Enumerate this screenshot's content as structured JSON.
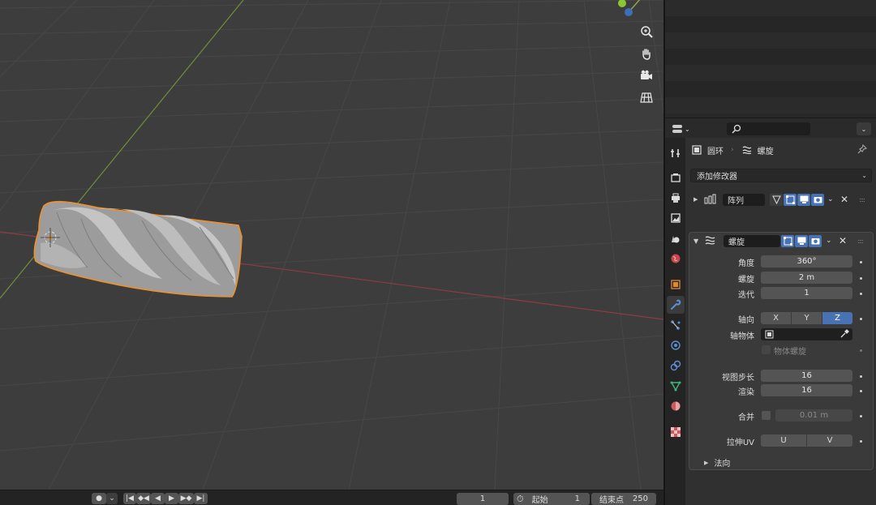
{
  "viewport": {
    "nav_icons": [
      "zoom-icon",
      "hand-pan-icon",
      "camera-icon",
      "grid-view-icon"
    ]
  },
  "timeline": {
    "current_frame": "1",
    "start_label": "起始",
    "start_value": "1",
    "end_label": "结束点",
    "end_value": "250"
  },
  "properties": {
    "search_placeholder": "",
    "breadcrumb": {
      "object": "圆环",
      "modifier": "螺旋"
    },
    "add_modifier": "添加修改器",
    "modifiers": [
      {
        "name": "阵列",
        "expanded": false
      },
      {
        "name": "螺旋",
        "expanded": true
      }
    ],
    "screw": {
      "angle_label": "角度",
      "angle_value": "360°",
      "screw_label": "螺旋",
      "screw_value": "2 m",
      "iterations_label": "迭代",
      "iterations_value": "1",
      "axis_label": "轴向",
      "axis_options": [
        "X",
        "Y",
        "Z"
      ],
      "axis_selected": "Z",
      "axis_object_label": "轴物体",
      "object_screw_label": "物体螺旋",
      "steps_viewport_label": "视图步长",
      "steps_viewport_value": "16",
      "render_label": "渲染",
      "render_value": "16",
      "merge_label": "合并",
      "merge_value": "0.01 m",
      "stretch_uv_label": "拉伸UV",
      "uv_options": [
        "U",
        "V"
      ],
      "normals_label": "法向"
    }
  },
  "colors": {
    "accent": "#4772b3",
    "selection_outline": "#f0902a",
    "x_axis": "#b5424b",
    "y_axis": "#78a33a"
  }
}
